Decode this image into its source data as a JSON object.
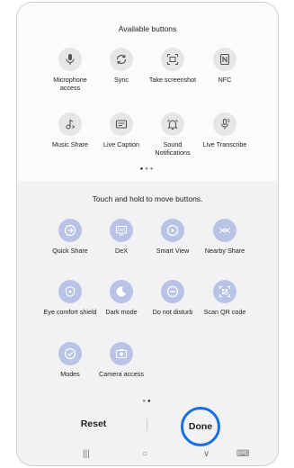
{
  "available": {
    "title": "Available buttons",
    "items": [
      {
        "label": "Microphone access",
        "icon": "microphone-icon"
      },
      {
        "label": "Sync",
        "icon": "sync-icon"
      },
      {
        "label": "Take screenshot",
        "icon": "screenshot-icon"
      },
      {
        "label": "NFC",
        "icon": "nfc-icon"
      },
      {
        "label": "Music Share",
        "icon": "music-share-icon"
      },
      {
        "label": "Live Caption",
        "icon": "live-caption-icon"
      },
      {
        "label": "Sound Notifications",
        "icon": "sound-notifications-icon"
      },
      {
        "label": "Live Transcribe",
        "icon": "live-transcribe-icon"
      }
    ]
  },
  "active": {
    "hint": "Touch and hold to move buttons.",
    "items": [
      {
        "label": "Quick Share",
        "icon": "quick-share-icon"
      },
      {
        "label": "DeX",
        "icon": "dex-icon"
      },
      {
        "label": "Smart View",
        "icon": "smart-view-icon"
      },
      {
        "label": "Nearby Share",
        "icon": "nearby-share-icon"
      },
      {
        "label": "Eye comfort shield",
        "icon": "eye-comfort-icon"
      },
      {
        "label": "Dark mode",
        "icon": "dark-mode-icon"
      },
      {
        "label": "Do not disturb",
        "icon": "do-not-disturb-icon"
      },
      {
        "label": "Scan QR code",
        "icon": "qr-code-icon"
      },
      {
        "label": "Modes",
        "icon": "modes-icon"
      },
      {
        "label": "Camera access",
        "icon": "camera-icon"
      }
    ]
  },
  "footer": {
    "reset_label": "Reset",
    "done_label": "Done"
  },
  "navbar": {
    "recents": "|||",
    "home": "○",
    "back": "∨",
    "keyboard": "⌨"
  },
  "colors": {
    "accent_ring": "#1a6fe0",
    "active_circle": "#b9c3e6"
  }
}
